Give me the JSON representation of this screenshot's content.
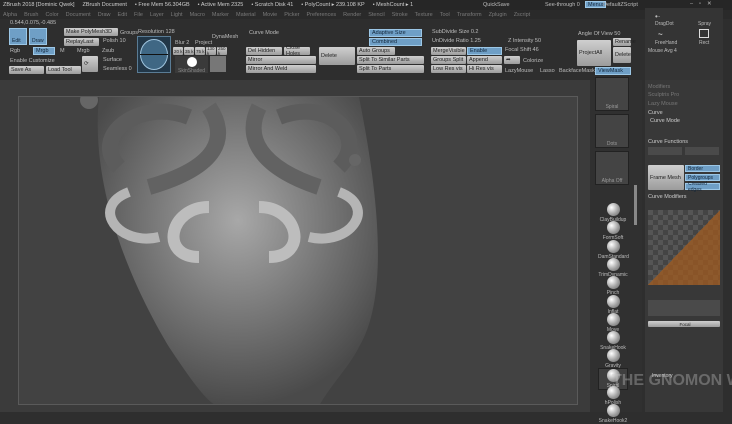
{
  "title": {
    "app": "ZBrush 2018 [Dominic Qwek]",
    "doc": "ZBrush Document",
    "free_mem": "• Free Mem 56.304GB",
    "active_mem": "• Active Mem 2325",
    "scratch": "• Scratch Disk 41",
    "polycount": "• PolyCount ▸ 239.108 KP",
    "meshcount": "• MeshCount ▸ 1"
  },
  "menu": [
    "Alpha",
    "Brush",
    "Color",
    "Document",
    "Draw",
    "Edit",
    "File",
    "Layer",
    "Light",
    "Macro",
    "Marker",
    "Material",
    "Movie",
    "Picker",
    "Preferences",
    "Render",
    "Stencil",
    "Stroke",
    "Texture",
    "Tool",
    "Transform",
    "Zplugin",
    "Zscript"
  ],
  "top_right": {
    "quicksave": "QuickSave",
    "seethrough": "See-through 0",
    "menus": "Menus",
    "script": "DefaultZScript"
  },
  "coords": "0.544,0.075,-0.485",
  "toolbar": {
    "edit": "Edit",
    "draw": "Draw",
    "make_polymesh": "Make PolyMesh3D",
    "replay_last": "ReplayLast",
    "rgb": "Rgb",
    "mrgb_mode": "Mrgb",
    "m": "M",
    "mrgb": "Mrgb",
    "zsub": "Zsub",
    "enable_customize": "Enable Customize",
    "save_as": "Save As",
    "load_tool": "Load Tool",
    "groups": "Groups",
    "resolution": "Resolution 128",
    "polish": "Polish 10",
    "surface": "Surface",
    "seamless": "Seamless 0",
    "blur": "Blur 2",
    "project": "Project",
    "dynamesh": "DynaMesh",
    "res_presets": [
      "20 k",
      "35 k",
      "75 k",
      "130 k",
      "250 k"
    ],
    "skinshaded": "SkinShaded",
    "curve_mode": "Curve Mode",
    "del_hidden": "Del Hidden",
    "close_holes": "Close Holes",
    "delete": "Delete",
    "mirror": "Mirror",
    "mirror_weld": "Mirror And Weld",
    "adaptive_size": "Adaptive Size",
    "combined": "Combined",
    "auto_groups": "Auto Groups",
    "split_similar": "Split To Similar Parts",
    "split_parts": "Split To Parts",
    "subdivide_size": "SubDivide Size 0.2",
    "undivide_ratio": "UnDivide Ratio 1.25",
    "merge_visible": "MergeVisible",
    "enable": "Enable",
    "groups_split": "Groups Split",
    "append": "Append",
    "low_res": "Low Res vis",
    "hi_res": "Hi Res vis",
    "z_intensity": "Z Intensity 50",
    "focal_shift": "Focal Shift 46",
    "colorize": "Colorize",
    "angle_of_view": "Angle Of View 50",
    "project_all": "ProjectAll",
    "rename": "Rename",
    "delete2": "Delete",
    "lazymouse": "LazyMouse",
    "lasso": "Lasso",
    "backface": "BackfaceMask",
    "viewmask": "ViewMask"
  },
  "strokes": {
    "dragdot": "DragDot",
    "spray": "Spray",
    "freehand": "FreeHand",
    "rect": "Rect",
    "mouse_avg": "Mouse Avg 4"
  },
  "panel": {
    "modifiers": "Modifiers",
    "sculptris": "Sculptris Pro",
    "lazy_mouse": "Lazy Mouse",
    "curve": "Curve",
    "curve_mode": "Curve Mode",
    "curve_functions": "Curve Functions",
    "frame_mesh": "Frame Mesh",
    "border": "Border",
    "polygroups": "Polygroups",
    "creased": "Creased edges",
    "curve_modifiers": "Curve Modifiers",
    "focal": "Focal",
    "inventory": "Inventory"
  },
  "alphas": [
    "Spiral",
    "Dots",
    "Alpha Off"
  ],
  "brushes": [
    "ClayBuildup",
    "FormSoft",
    "DamStandard",
    "TrimDynamic",
    "Pinch",
    "Inflat",
    "Move",
    "SnakeHook",
    "Gravity",
    "Spiral",
    "hPolish",
    "SnakeHook2"
  ],
  "watermark": "THE GNOMON WORKSHOP"
}
